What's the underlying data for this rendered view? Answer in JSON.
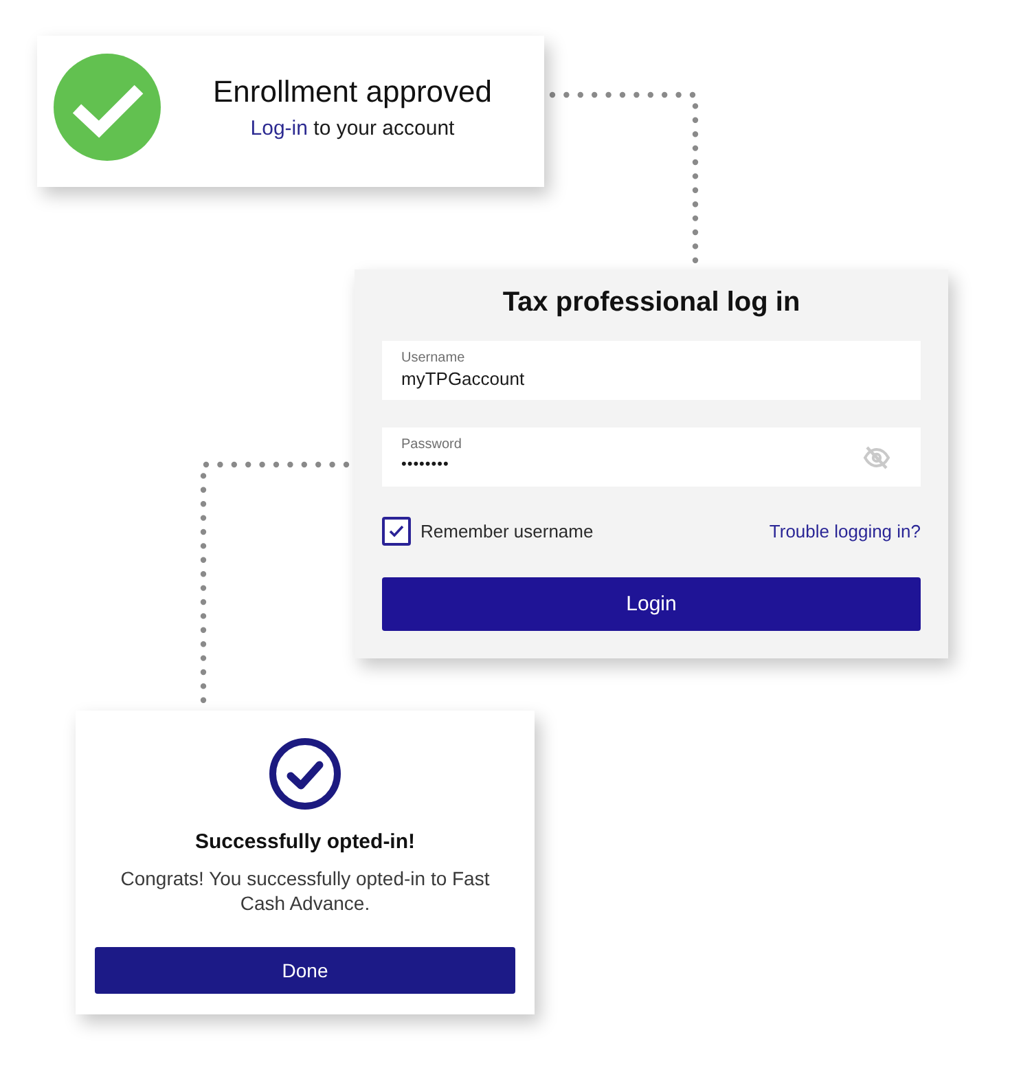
{
  "enrollment_card": {
    "title": "Enrollment approved",
    "link": "Log-in",
    "text": "to your account"
  },
  "login_card": {
    "title": "Tax professional log in",
    "fields": [
      {
        "kind": "text",
        "label": "Username",
        "value": "myTPGaccount"
      },
      {
        "kind": "password",
        "label": "Password",
        "value": "••••••••"
      }
    ],
    "remember": {
      "label": "Remember username",
      "checked": true
    },
    "help_link": "Trouble logging in?",
    "button": "Login"
  },
  "success_card": {
    "title": "Successfully opted-in!",
    "message": "Congrats! You successfully opted-in to Fast Cash Advance.",
    "button": "Done"
  }
}
